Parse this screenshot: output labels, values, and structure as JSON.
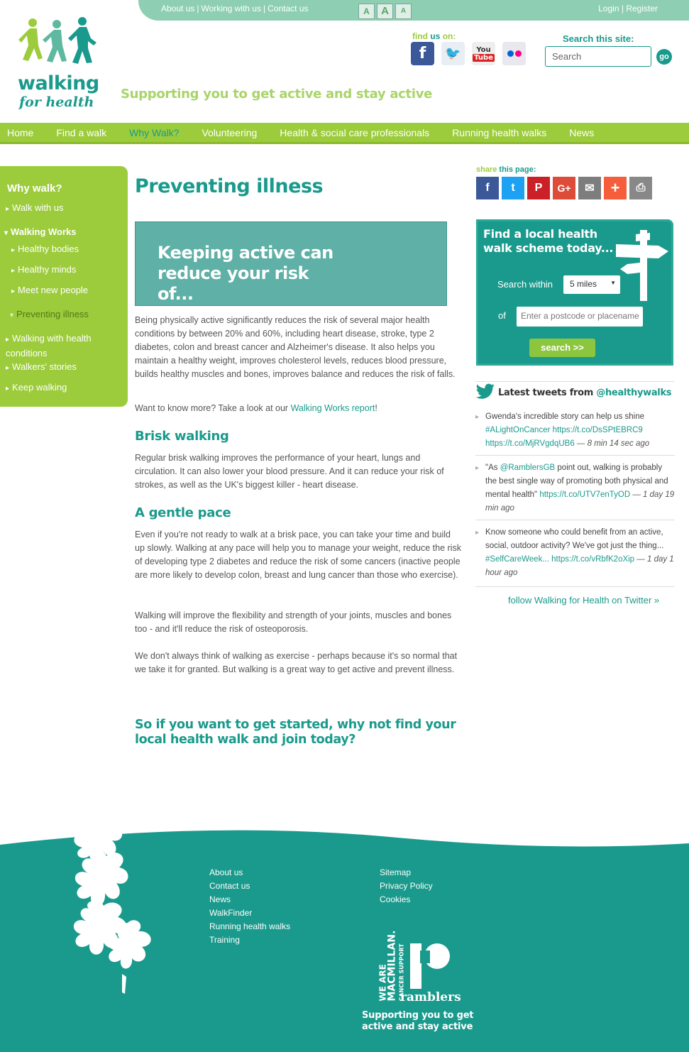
{
  "topbar": {
    "links": [
      "About us",
      "Working with us",
      "Contact us"
    ],
    "text_sizes": [
      "A",
      "A",
      "A"
    ],
    "account_links": [
      "Login",
      "Register"
    ]
  },
  "logo": {
    "line1": "walking",
    "line2": "for health"
  },
  "tagline": "Supporting you to get active and stay active",
  "findus": {
    "label_a": "find",
    "label_b": "us",
    "label_c": "on:",
    "icons": [
      "facebook-icon",
      "twitter-icon",
      "youtube-icon",
      "flickr-icon"
    ],
    "yt_top": "You",
    "yt_bottom": "Tube"
  },
  "search": {
    "label": "Search this site:",
    "placeholder": "Search",
    "go_label": "go"
  },
  "nav": {
    "items": [
      "Home",
      "Find a walk",
      "Why Walk?",
      "Volunteering",
      "Health & social care professionals",
      "Running health walks",
      "News"
    ],
    "active": "Why Walk?"
  },
  "sidebar": {
    "heading": "Why walk?",
    "items": [
      "Walk with us",
      "Walking Works",
      "Healthy bodies",
      "Healthy minds",
      "Meet new people",
      "Preventing illness",
      "Walking with health conditions",
      "Walkers' stories",
      "Keep walking"
    ]
  },
  "main": {
    "title": "Preventing illness",
    "banner": "Keeping active can reduce your risk of...",
    "para1": "Being physically active significantly reduces the risk of several major health conditions by between 20% and 60%, including heart disease, stroke, type 2 diabetes, colon and breast cancer and Alzheimer's disease. It also helps you maintain a healthy weight, improves cholesterol levels, reduces blood pressure, builds healthy muscles and bones, improves balance and reduces the risk of falls.",
    "para2_pre": "Want to know more? Take a look at our ",
    "para2_link": "Walking Works report",
    "para2_post": "!",
    "h_brisk": "Brisk walking",
    "para3": "Regular brisk walking improves the performance of your heart, lungs and circulation. It can also lower your blood pressure. And it can reduce your risk of strokes, as well as the UK's biggest killer - heart disease.",
    "h_gentle": "A gentle pace",
    "para4": "Even if you're not ready to walk at a brisk pace, you can take your time and build up slowly. Walking at any pace will help you to manage your weight, reduce the risk of developing type 2 diabetes and reduce the risk of some cancers (inactive people are more likely to develop colon, breast and lung cancer than those who exercise).",
    "para5": "Walking will improve the flexibility and strength of your joints, muscles and bones too - and it'll reduce the risk of osteoporosis.",
    "para6": "We don't always think of walking as exercise - perhaps because it's so normal that we take it for granted. But walking is a great way to get active and prevent illness.",
    "cta": "So if you want to get started, why not find your local health walk and join today?"
  },
  "share": {
    "label_a": "share",
    "label_b": "this",
    "label_c": "page:",
    "icons": [
      "facebook-share-icon",
      "twitter-share-icon",
      "pinterest-share-icon",
      "google-plus-share-icon",
      "email-share-icon",
      "add-share-icon",
      "print-icon"
    ],
    "colors": [
      "#3b5998",
      "#1da1f2",
      "#cb2027",
      "#dd4b39",
      "#7d7d7d",
      "#f65e3b",
      "#888888"
    ],
    "glyphs": [
      "f",
      "t",
      "P",
      "G+",
      "✉",
      "+",
      "⎙"
    ]
  },
  "walkfinder": {
    "title": "Find a local health walk scheme today...",
    "search_within": "Search within",
    "miles": "5 miles",
    "of": "of",
    "placeholder": "Enter a postcode or placename",
    "button": "search >>"
  },
  "tweets": {
    "title_pre": "Latest tweets from ",
    "handle": "@healthywalks",
    "items": [
      {
        "text": "Gwenda's incredible story can help us shine",
        "links": "#ALightOnCancer https://t.co/DsSPtEBRC9 https://t.co/MjRVgdqUB6",
        "time": " — 8 min 14 sec ago"
      },
      {
        "pre": "\"As ",
        "mention": "@RamblersGB",
        "text": " point out, walking is probably the best single way of promoting both physical and mental health\" ",
        "links": "https://t.co/UTV7enTyOD",
        "time": " — 1 day 19 min ago"
      },
      {
        "text": "Know someone who could benefit from an active, social, outdoor activity? We've got just the thing... ",
        "links": "#SelfCareWeek... https://t.co/vRbfK2oXip",
        "time": " — 1 day 1 hour ago"
      }
    ],
    "follow": "follow Walking for Health on Twitter »"
  },
  "footer": {
    "col1": [
      "About us",
      "Contact us",
      "News",
      "WalkFinder",
      "Running health walks",
      "Training"
    ],
    "col2": [
      "Sitemap",
      "Privacy Policy",
      "Cookies"
    ],
    "macmillan_a": "WE ARE",
    "macmillan_b": "MACMILLAN.",
    "macmillan_c": "CANCER SUPPORT",
    "ramblers": "ramblers",
    "tagline": "Supporting you to get active and stay active"
  },
  "colors": {
    "teal": "#1a9a8c",
    "green": "#9ccc3c",
    "mint": "#8ecfb3"
  }
}
